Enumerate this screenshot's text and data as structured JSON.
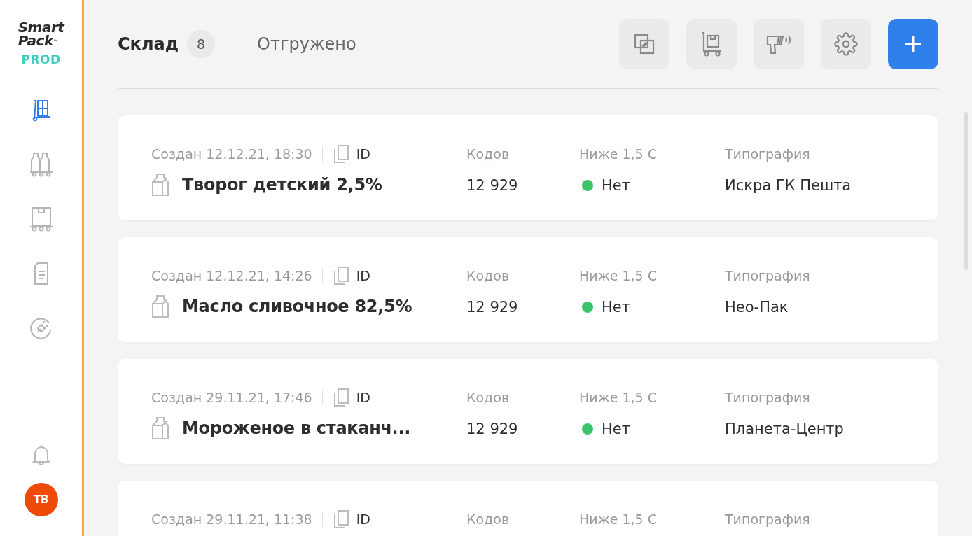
{
  "sidebar": {
    "logo": {
      "line1": "Smart",
      "line2": "Pack",
      "mark": "™"
    },
    "environment": "PROD",
    "nav": [
      {
        "selected": true
      },
      {
        "selected": false
      },
      {
        "selected": false
      },
      {
        "selected": false
      },
      {
        "selected": false
      }
    ],
    "avatar": {
      "initials": "ТВ"
    }
  },
  "tabs": [
    {
      "label": "Склад",
      "count": "8",
      "selected": true
    },
    {
      "label": "Отгружено",
      "selected": false
    }
  ],
  "rows": [
    {
      "created": "Создан 12.12.21, 18:30",
      "id_label": "ID",
      "title": "Творог детский 2,5%",
      "codes_label": "Кодов",
      "codes": "12 929",
      "temp_label": "Ниже 1,5 С",
      "temp": "Нет",
      "color": "#3cc46a",
      "printer_label": "Типография",
      "printer": "Искра ГК Пешта"
    },
    {
      "created": "Создан 12.12.21, 14:26",
      "id_label": "ID",
      "title": "Масло сливочное 82,5%",
      "codes_label": "Кодов",
      "codes": "12 929",
      "temp_label": "Ниже 1,5 С",
      "temp": "Нет",
      "color": "#3cc46a",
      "printer_label": "Типография",
      "printer": "Нео-Пак"
    },
    {
      "created": "Создан 29.11.21, 17:46",
      "id_label": "ID",
      "title": "Мороженое в стаканч...",
      "codes_label": "Кодов",
      "codes": "12 929",
      "temp_label": "Ниже 1,5 С",
      "temp": "Нет",
      "color": "#3cc46a",
      "printer_label": "Типография",
      "printer": "Планета-Центр"
    },
    {
      "created": "Создан 29.11.21, 11:38",
      "id_label": "ID",
      "codes_label": "Кодов",
      "temp_label": "Ниже 1,5 С",
      "printer_label": "Типография"
    }
  ]
}
